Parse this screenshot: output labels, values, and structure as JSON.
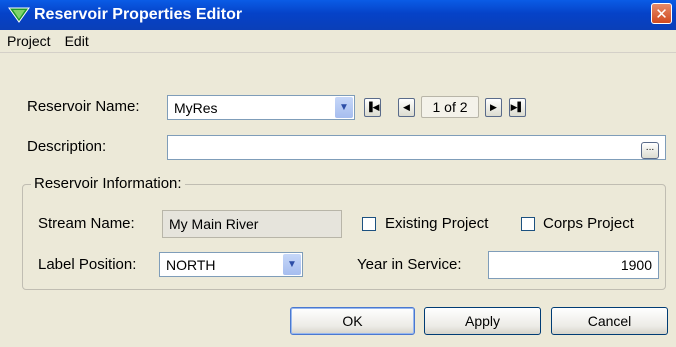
{
  "window": {
    "title": "Reservoir Properties Editor",
    "close_glyph": "✕"
  },
  "menu": [
    "Project",
    "Edit"
  ],
  "reservoir": {
    "name_label": "Reservoir Name:",
    "name_value": "MyRes",
    "nav": {
      "first": "▐◀",
      "prev": "◀",
      "next": "▶",
      "last": "▶▌",
      "count": "1 of 2"
    },
    "description_label": "Description:",
    "description_value": "",
    "ellipsis": "..."
  },
  "info": {
    "group_title": "Reservoir Information:",
    "stream_label": "Stream Name:",
    "stream_value": "My Main River",
    "existing_label": "Existing Project",
    "existing_checked": false,
    "corps_label": "Corps Project",
    "corps_checked": false,
    "label_position_label": "Label Position:",
    "label_position_value": "NORTH",
    "year_label": "Year in Service:",
    "year_value": "1900"
  },
  "buttons": {
    "ok": "OK",
    "apply": "Apply",
    "cancel": "Cancel"
  },
  "colors": {
    "title_bar": "#0542c8",
    "window_bg": "#ece9d8",
    "field_border": "#7f9db9"
  }
}
